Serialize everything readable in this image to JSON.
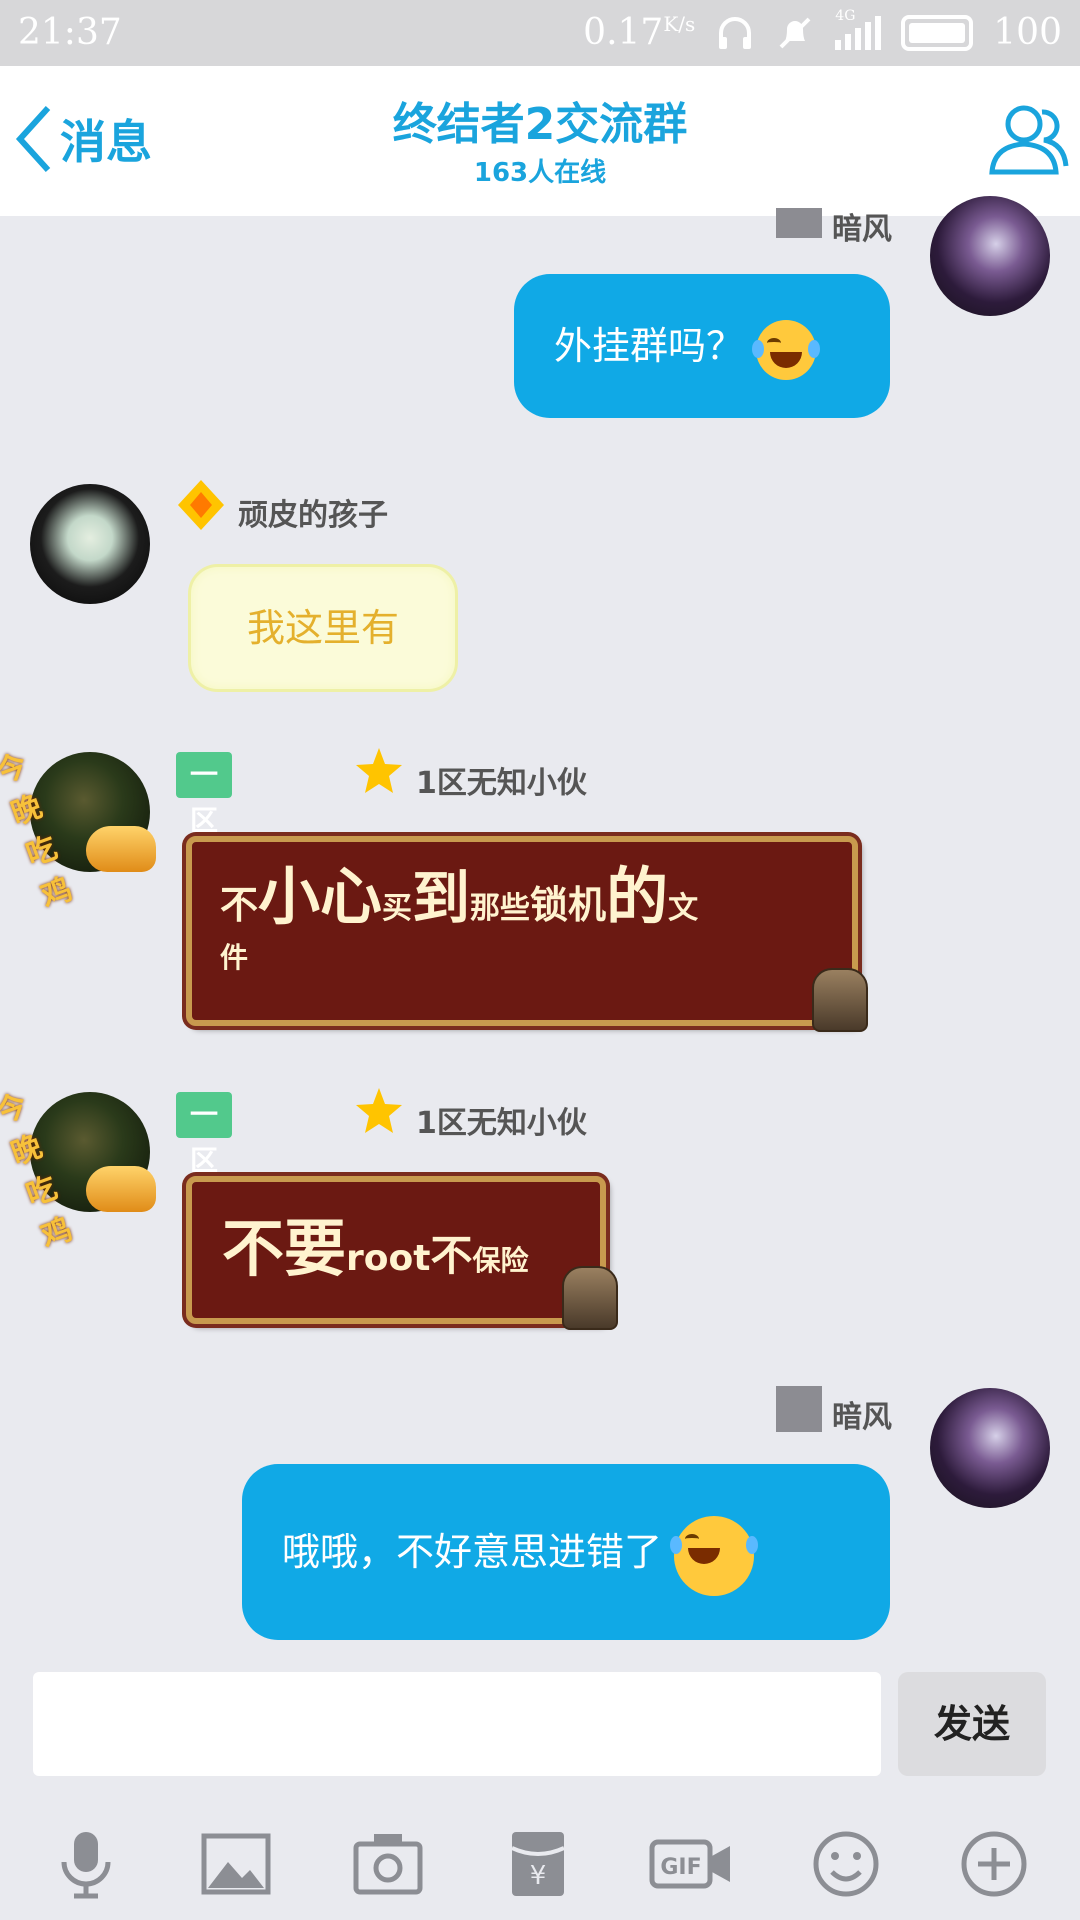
{
  "status_bar": {
    "time": "21:37",
    "speed": "0.17",
    "speed_unit": "K/s",
    "network": "4G",
    "battery": "100"
  },
  "header": {
    "back_label": "消息",
    "title": "终结者2交流群",
    "online": "163人在线"
  },
  "messages": [
    {
      "sender": "暗风",
      "text": "外挂群吗？",
      "emoji": "tears-of-joy"
    },
    {
      "sender": "顽皮的孩子",
      "text": "我这里有"
    },
    {
      "tag": "一区政委",
      "sender": "1区无知小伙",
      "parts": [
        "不",
        "小心",
        "买",
        "到",
        "那些",
        "锁机",
        "的",
        "文",
        "件"
      ]
    },
    {
      "tag": "一区政委",
      "sender": "1区无知小伙",
      "parts": [
        "不要",
        "root",
        "不",
        "保险"
      ]
    },
    {
      "sender": "暗风",
      "text": "哦哦，不好意思进错了",
      "emoji": "tears-of-joy"
    }
  ],
  "avatar_text": "今晚吃鸡",
  "input": {
    "value": "",
    "send_label": "发送"
  },
  "toolbar": [
    "mic-icon",
    "image-icon",
    "camera-icon",
    "red-packet-icon",
    "gif-icon",
    "emoji-icon",
    "plus-icon"
  ],
  "colors": {
    "accent": "#1aa4dd",
    "bubble": "#10a9e6",
    "tag": "#52c98c",
    "background": "#e9eaef"
  }
}
